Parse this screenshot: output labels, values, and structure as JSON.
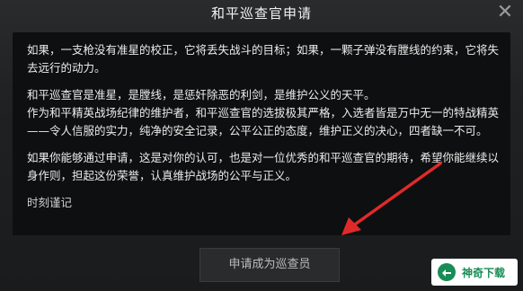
{
  "dialog": {
    "title": "和平巡查官申请",
    "close_glyph": "✕"
  },
  "content": {
    "paragraphs": [
      "如果，一支枪没有准星的校正，它将丢失战斗的目标；如果，一颗子弹没有膛线的约束，它将失去远行的动力。",
      "和平巡查官是准星，是膛线，是惩奸除恶的利剑，是维护公义的天平。",
      "作为和平精英战场纪律的维护者，和平巡查官的选拔极其严格，入选者皆是万中无一的特战精英——令人信服的实力，纯净的安全记录，公平公正的态度，维护正义的决心，四者缺一不可。",
      "如果你能够通过申请，这是对你的认可，也是对一位优秀的和平巡查官的期待，希望你能继续以身作则，担起这份荣誉，认真维护战场的公平与正义。",
      "时刻谨记"
    ]
  },
  "actions": {
    "apply_label": "申请成为巡查员"
  },
  "watermark": {
    "text": "神奇下载"
  },
  "colors": {
    "arrow": "#e02a2a",
    "panel": "#0e0f10",
    "watermark_green": "#1a8c55"
  }
}
